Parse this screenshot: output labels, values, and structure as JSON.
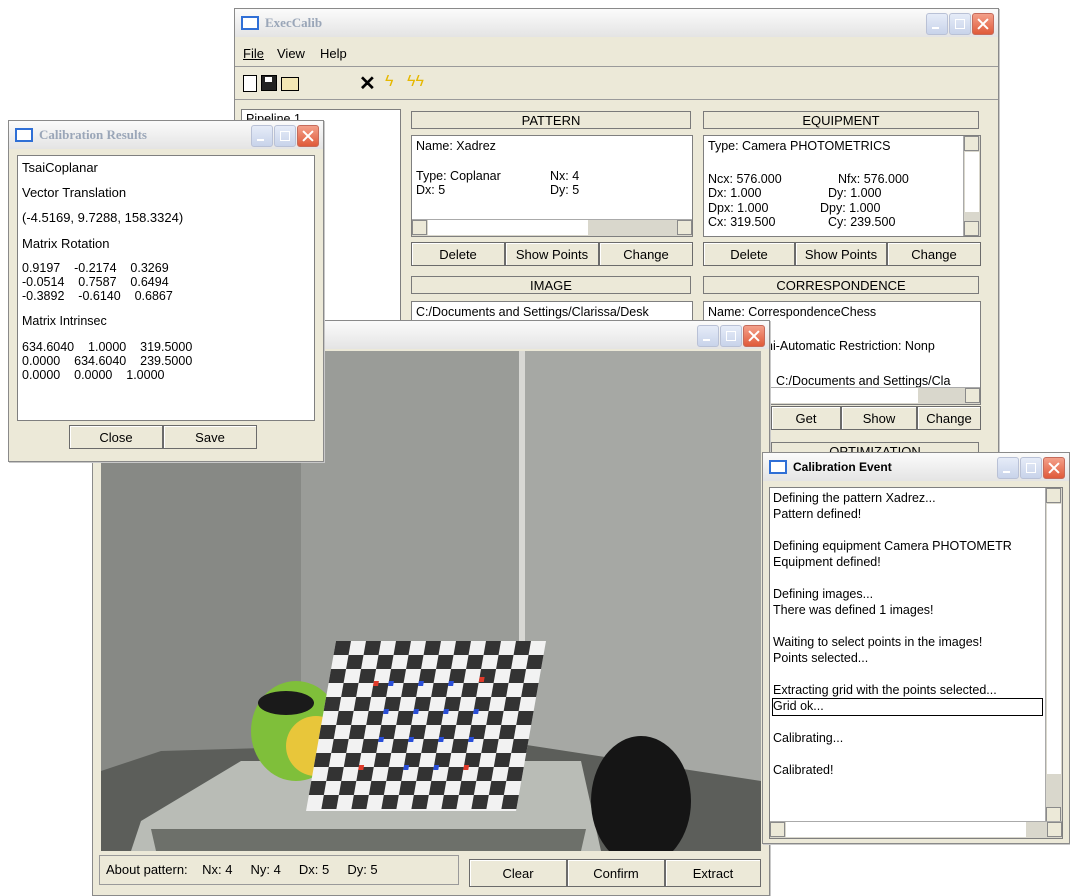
{
  "main_window": {
    "title": "ExecCalib",
    "menu": [
      "File",
      "View",
      "Help"
    ],
    "pipeline_label": "Pipeline 1"
  },
  "pattern": {
    "header": "PATTERN",
    "lines": [
      "Name: Xadrez",
      "",
      "Type: Coplanar",
      "Dx: 5"
    ],
    "nx": "Nx: 4",
    "dy": "Dy: 5",
    "buttons": [
      "Delete",
      "Show Points",
      "Change"
    ]
  },
  "equipment": {
    "header": "EQUIPMENT",
    "type": "Type: Camera PHOTOMETRICS",
    "ncx": "Ncx: 576.000",
    "nfx": "Nfx: 576.000",
    "dx": "Dx: 1.000",
    "dy": "Dy: 1.000",
    "dpx": "Dpx: 1.000",
    "dpy": "Dpy: 1.000",
    "cx": "Cx: 319.500",
    "cy": "Cy: 239.500",
    "buttons": [
      "Delete",
      "Show Points",
      "Change"
    ]
  },
  "image_panel": {
    "header": "IMAGE",
    "path": "C:/Documents and Settings/Clarissa/Desk"
  },
  "correspondence": {
    "header": "CORRESPONDENCE",
    "name": "Name: CorrespondenceChess",
    "mode": "ni-Automatic   Restriction: Nonp",
    "path": "C:/Documents and Settings/Cla",
    "buttons": [
      "Get",
      "Show",
      "Change"
    ]
  },
  "optimization": {
    "header": "OPTIMIZATION"
  },
  "calibration_results": {
    "title": "Calibration Results",
    "lines": [
      "TsaiCoplanar",
      "Vector Translation",
      "(-4.5169, 9.7288, 158.3324)",
      "Matrix Rotation",
      "0.9197    -0.2174    0.3269",
      "-0.0514    0.7587    0.6494",
      "-0.3892    -0.6140    0.6867",
      "Matrix Intrinsec",
      "634.6040    1.0000    319.5000",
      "0.0000    634.6040    239.5000",
      "0.0000    0.0000    1.0000"
    ],
    "buttons": [
      "Close",
      "Save"
    ]
  },
  "image_window": {
    "status": "About pattern:    Nx: 4     Ny: 4     Dx: 5     Dy: 5",
    "buttons": [
      "Clear",
      "Confirm",
      "Extract"
    ]
  },
  "calibration_event": {
    "title": "Calibration Event",
    "lines": [
      "Defining the pattern Xadrez...",
      "Pattern defined!",
      "",
      "Defining equipment Camera PHOTOMETR",
      "Equipment defined!",
      "",
      "Defining images...",
      "There was defined 1 images!",
      "",
      "Waiting to select points in the images!",
      "Points selected...",
      "",
      "Extracting grid with the points selected...",
      "Grid ok...",
      "",
      "Calibrating...",
      "",
      "Calibrated!"
    ]
  },
  "colors": {
    "window_bg": "#ece9d8",
    "title_icon": "#2f6fd6",
    "close_button": "#e05a3a"
  }
}
